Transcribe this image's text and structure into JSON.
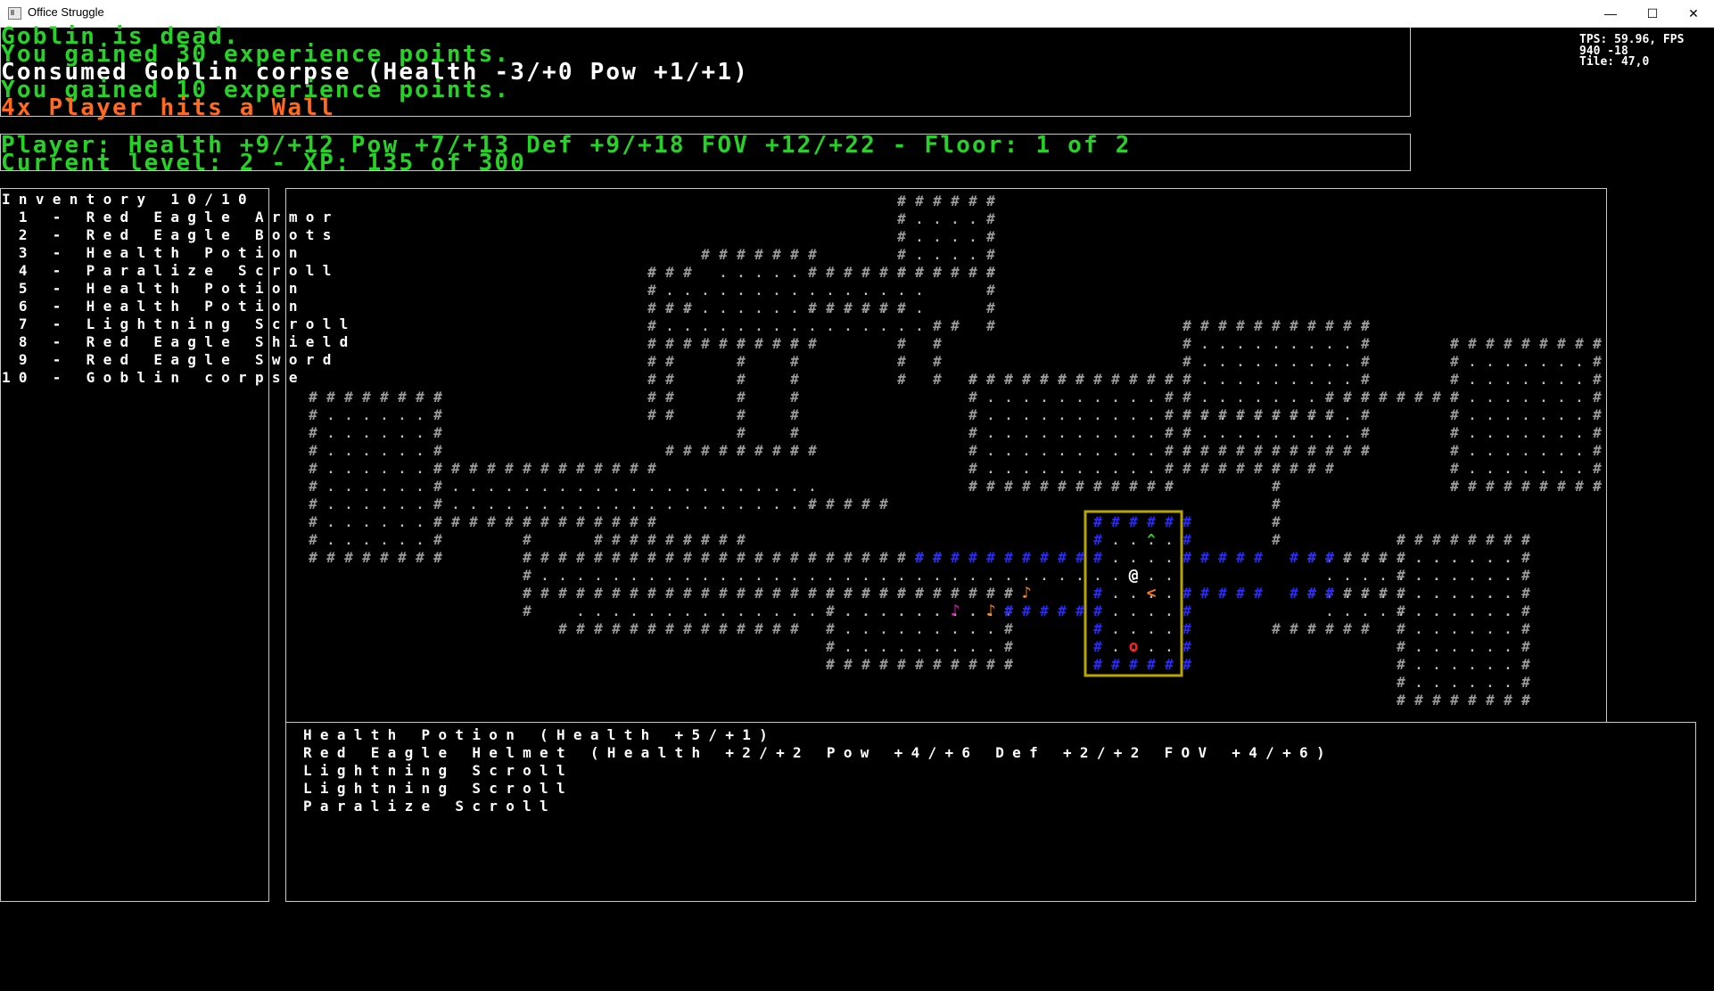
{
  "window": {
    "title": "Office Struggle",
    "minimize": "—",
    "maximize": "☐",
    "close": "✕"
  },
  "log": [
    {
      "text": "Goblin is dead.",
      "color": "green"
    },
    {
      "text": "You gained 30 experience points.",
      "color": "green"
    },
    {
      "text": "Consumed Goblin corpse (Health -3/+0 Pow +1/+1)",
      "color": "white"
    },
    {
      "text": "You gained 10 experience points.",
      "color": "green"
    },
    {
      "text": "4x Player hits a Wall",
      "color": "orange"
    }
  ],
  "stats": {
    "line1": "Player: Health +9/+12 Pow +7/+13 Def +9/+18 FOV +12/+22 - Floor: 1 of 2",
    "line2": "Current level: 2 - XP: 135 of 300"
  },
  "inventory": {
    "title": "Inventory 10/10",
    "items": [
      " 1 - Red Eagle Armor",
      " 2 - Red Eagle Boots",
      " 3 - Health Potion",
      " 4 - Paralize Scroll",
      " 5 - Health Potion",
      " 6 - Health Potion",
      " 7 - Lightning Scroll",
      " 8 - Red Eagle Shield",
      " 9 - Red Eagle Sword",
      "10 - Goblin corpse"
    ]
  },
  "ground_items": [
    "Health Potion (Health +5/+1)",
    "Red Eagle Helmet (Health +2/+2 Pow +4/+6 Def +2/+2 FOV +4/+6)",
    "Lightning Scroll",
    "Lightning Scroll",
    "Paralize Scroll"
  ],
  "debug": {
    "line1": "TPS: 59.96, FPS",
    "line2": "940 -18",
    "line3": "Tile: 47,0"
  },
  "map": {
    "glyphs": {
      "wall": "#",
      "floor": ".",
      "player": "@",
      "stairs": "<",
      "item": "^",
      "note": "♪",
      "ring": "o"
    },
    "colors": {
      "wall": "#9a9a9a",
      "door_wall": "#2a2aff",
      "door_border": "#b8a600",
      "player": "#ffffff",
      "stairs": "#ff7a1a",
      "item": "#27d227",
      "note_orange": "#ff8a1a",
      "note_pink": "#e020c0",
      "ring": "#ff2020"
    }
  }
}
